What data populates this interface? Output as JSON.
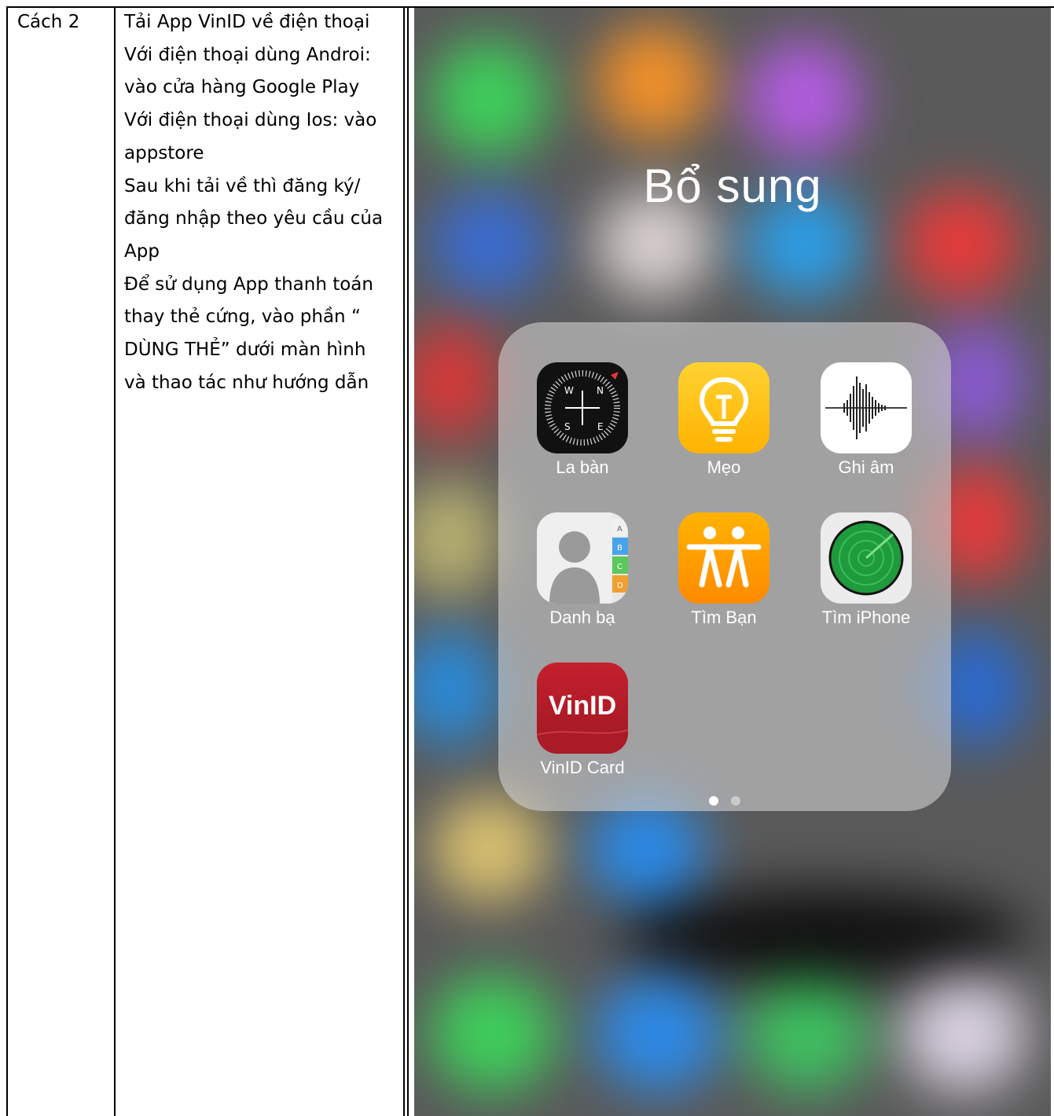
{
  "table": {
    "method": "Cách 2",
    "steps": [
      "Tải App VinID về điện thoại",
      "Với điện thoại dùng Androi:",
      "vào cửa hàng Google Play",
      "Với điện thoại dùng Ios: vào",
      "appstore",
      "Sau khi tải về thì đăng ký/",
      "đăng nhập theo yêu cầu của",
      "App",
      "Để sử dụng App thanh toán",
      "thay thẻ cứng, vào phần “",
      "DÙNG THẺ” dưới màn hình",
      "và thao tác như hướng dẫn"
    ]
  },
  "phone": {
    "folder_title": "Bổ sung",
    "apps": {
      "compass": {
        "label": "La bàn",
        "icon": "compass-icon"
      },
      "tips": {
        "label": "Mẹo",
        "icon": "lightbulb-icon"
      },
      "voice_memos": {
        "label": "Ghi âm",
        "icon": "waveform-icon"
      },
      "contacts": {
        "label": "Danh bạ",
        "icon": "contacts-icon"
      },
      "find_friends": {
        "label": "Tìm Bạn",
        "icon": "friends-icon"
      },
      "find_iphone": {
        "label": "Tìm iPhone",
        "icon": "radar-icon"
      },
      "vinid": {
        "label": "VinID Card",
        "icon_text": "VinID",
        "icon": "vinid-logo-icon"
      }
    },
    "compass_letters": {
      "n": "N",
      "e": "E",
      "s": "S",
      "w": "W"
    },
    "contacts_tabs": [
      "A",
      "B",
      "C",
      "D"
    ],
    "page_dots": 2,
    "colors": {
      "vinid_red": "#b8202c",
      "tips_yellow": "#ffc20e",
      "findfriends_orange": "#ff9f0a",
      "radar_green": "#27a844"
    }
  }
}
